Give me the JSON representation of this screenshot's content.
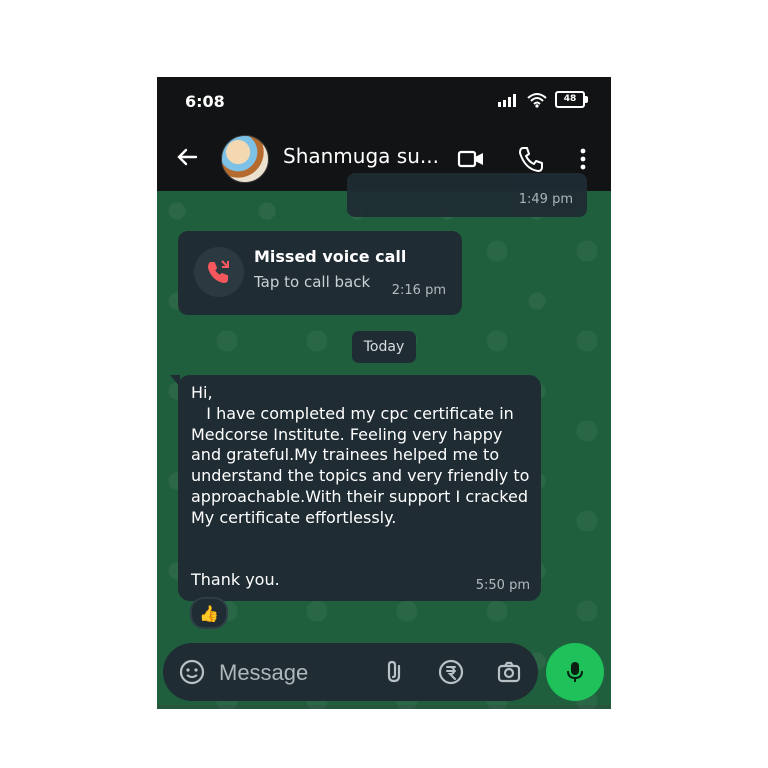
{
  "status_bar": {
    "time": "6:08",
    "battery": "48",
    "icons": [
      "signal-icon",
      "wifi-icon",
      "battery-icon"
    ]
  },
  "header": {
    "contact_name": "Shanmuga su...",
    "icons": [
      "back-arrow-icon",
      "video-call-icon",
      "phone-icon",
      "more-options-icon"
    ]
  },
  "chat": {
    "top_partial_time": "1:49 pm",
    "missed_call": {
      "title": "Missed voice call",
      "subtitle": "Tap to call back",
      "time": "2:16 pm",
      "icon": "missed-call-icon"
    },
    "date_divider": "Today",
    "message": {
      "text": "Hi,\n   I have completed my cpc certificate in Medcorse Institute. Feeling very happy and grateful.My trainees helped me to understand the topics and very friendly to approachable.With their support I cracked My certificate effortlessly.\n\n\nThank you.",
      "time": "5:50 pm",
      "reaction": "👍"
    }
  },
  "composer": {
    "placeholder": "Message",
    "icons": [
      "sticker-icon",
      "attachment-icon",
      "rupee-icon",
      "camera-icon",
      "mic-icon"
    ]
  },
  "colors": {
    "bar_bg": "#111314",
    "chat_bg": "#1f5f3d",
    "bubble_bg": "#1f2c33",
    "accent_green": "#1ec15a",
    "missed_red": "#ff5a5f"
  }
}
